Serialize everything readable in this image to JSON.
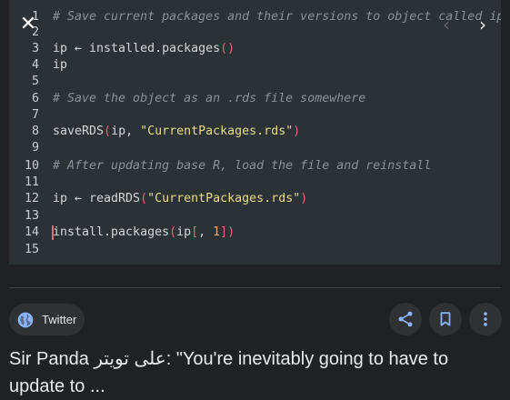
{
  "code_lines": [
    {
      "n": "1",
      "segments": [
        {
          "t": "# Save current packages and their versions to object called ip",
          "c": "comment"
        }
      ]
    },
    {
      "n": "2",
      "segments": []
    },
    {
      "n": "3",
      "segments": [
        {
          "t": "ip ← installed.packages",
          "c": ""
        },
        {
          "t": "()",
          "c": "paren"
        }
      ]
    },
    {
      "n": "4",
      "segments": [
        {
          "t": "ip",
          "c": ""
        }
      ]
    },
    {
      "n": "5",
      "segments": []
    },
    {
      "n": "6",
      "segments": [
        {
          "t": "# Save the object as an .rds file somewhere",
          "c": "comment"
        }
      ]
    },
    {
      "n": "7",
      "segments": []
    },
    {
      "n": "8",
      "segments": [
        {
          "t": "saveRDS",
          "c": ""
        },
        {
          "t": "(",
          "c": "paren"
        },
        {
          "t": "ip, ",
          "c": ""
        },
        {
          "t": "\"CurrentPackages.rds\"",
          "c": "str"
        },
        {
          "t": ")",
          "c": "paren"
        }
      ]
    },
    {
      "n": "9",
      "segments": []
    },
    {
      "n": "10",
      "segments": [
        {
          "t": "# After updating base R, load the file and reinstall",
          "c": "comment"
        }
      ]
    },
    {
      "n": "11",
      "segments": []
    },
    {
      "n": "12",
      "segments": [
        {
          "t": "ip ← readRDS",
          "c": ""
        },
        {
          "t": "(",
          "c": "paren"
        },
        {
          "t": "\"CurrentPackages.rds\"",
          "c": "str"
        },
        {
          "t": ")",
          "c": "paren"
        }
      ]
    },
    {
      "n": "13",
      "segments": []
    },
    {
      "n": "14",
      "segments": [
        {
          "t": "install.packages",
          "c": ""
        },
        {
          "t": "(",
          "c": "paren"
        },
        {
          "t": "ip",
          "c": ""
        },
        {
          "t": "[",
          "c": "paren"
        },
        {
          "t": ", ",
          "c": ""
        },
        {
          "t": "1",
          "c": "num"
        },
        {
          "t": "])",
          "c": "paren"
        }
      ],
      "cursor": true
    },
    {
      "n": "15",
      "segments": []
    }
  ],
  "viewer": {
    "close_icon": "close-icon",
    "prev_icon": "chevron-left-icon",
    "next_icon": "chevron-right-icon"
  },
  "source": {
    "label": "Twitter",
    "icon": "globe-icon",
    "icon_color": "#8ab4f8"
  },
  "actions": {
    "share_icon": "share-icon",
    "bookmark_icon": "bookmark-icon",
    "more_icon": "more-vert-icon",
    "icon_color": "#8ab4f8"
  },
  "title": "Sir Panda على تويتر: \"You're inevitably going to have to update to ..."
}
